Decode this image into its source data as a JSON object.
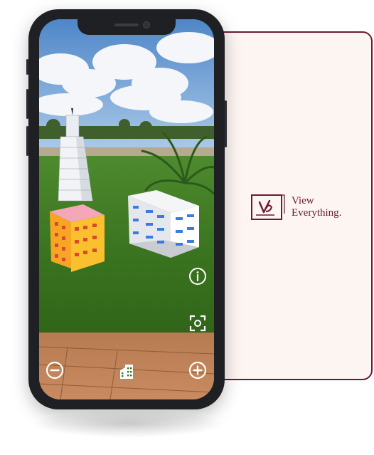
{
  "brand": {
    "line1": "View",
    "line2": "Everything.",
    "color": "#6b1a33",
    "card_background": "#fcf5f1"
  },
  "ar_controls": {
    "info": "info-icon",
    "scan": "focus-scan-icon",
    "zoom_out": "zoom-out-icon",
    "buildings": "buildings-icon",
    "zoom_in": "zoom-in-icon"
  }
}
